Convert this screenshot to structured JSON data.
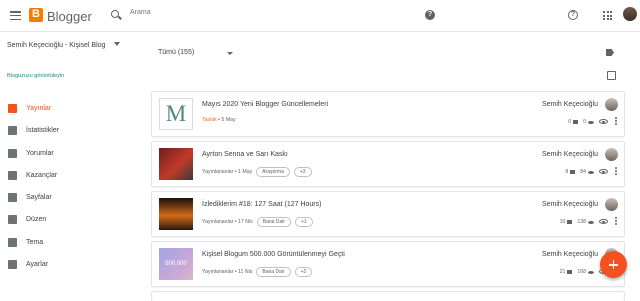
{
  "app": {
    "brand": "Blogger",
    "search_placeholder": "Arama"
  },
  "sidebar": {
    "blog_name": "Semih Keçecioğlu - Kişisel Blog",
    "view_blog": "Bloguzuzu görüntüleyin",
    "items": [
      {
        "label": "Yayınlar",
        "icon": "posts-icon",
        "active": true
      },
      {
        "label": "İstatistikler",
        "icon": "stats-icon"
      },
      {
        "label": "Yorumlar",
        "icon": "comments-icon"
      },
      {
        "label": "Kazançlar",
        "icon": "earnings-icon"
      },
      {
        "label": "Sayfalar",
        "icon": "pages-icon"
      },
      {
        "label": "Düzen",
        "icon": "layout-icon"
      },
      {
        "label": "Tema",
        "icon": "theme-icon"
      },
      {
        "label": "Ayarlar",
        "icon": "settings-icon"
      }
    ]
  },
  "main": {
    "filter_label": "Tümü (155)",
    "posts": [
      {
        "title": "Mayıs 2020 Yeni Blogger Güncellemeleri",
        "status": "Taslak",
        "date": "5 May",
        "labels": [],
        "author": "Semih Keçecioğlu",
        "comments": "0",
        "views": "0"
      },
      {
        "title": "Ayrton Senna ve Sarı Kaskı",
        "status": "Yayınlananlar",
        "date": "1 May",
        "labels": [
          "Araştırma",
          "+3"
        ],
        "author": "Semih Keçecioğlu",
        "comments": "8",
        "views": "84"
      },
      {
        "title": "İzlediklerim #18: 127 Saat (127 Hours)",
        "status": "Yayınlananlar",
        "date": "17 Nis",
        "labels": [
          "Bana Dair",
          "+1"
        ],
        "author": "Semih Keçecioğlu",
        "comments": "10",
        "views": "138"
      },
      {
        "title": "Kişisel Blogum 500.000 Görüntülenmeyi Geçti",
        "status": "Yayınlananlar",
        "date": "11 Nis",
        "labels": [
          "Bana Dair",
          "+2"
        ],
        "author": "Semih Keçecioğlu",
        "comments": "21",
        "views": "168",
        "thumb_text": "500.000"
      }
    ]
  },
  "colors": {
    "accent": "#f4511e",
    "draft": "#e8710a",
    "link": "#1a8a7f"
  }
}
